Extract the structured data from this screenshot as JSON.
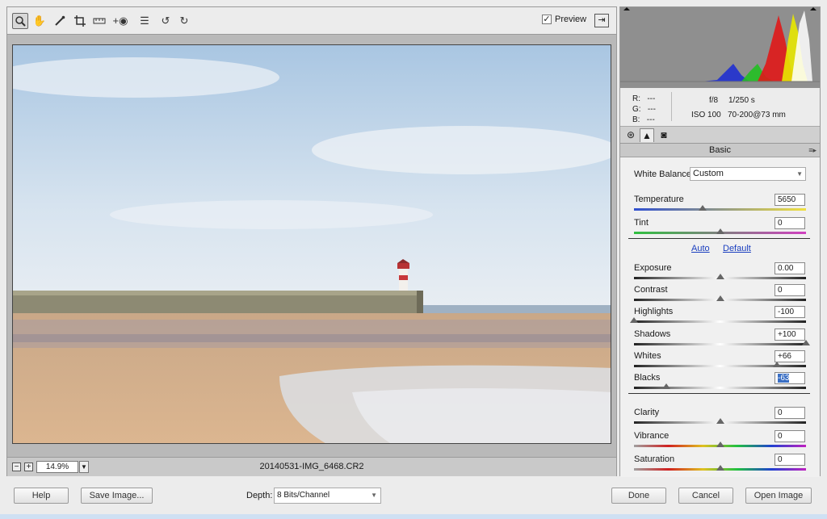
{
  "toolbar": {
    "tools": [
      "zoom-tool",
      "hand-tool",
      "white-balance-tool",
      "crop-tool",
      "straighten-tool",
      "red-eye-tool",
      "preferences-tool",
      "rotate-ccw-tool",
      "rotate-cw-tool"
    ],
    "preview_label": "Preview",
    "preview_checked": true
  },
  "bottom_bar": {
    "zoom_out": "−",
    "zoom_in": "+",
    "zoom_value": "14.9%",
    "filename": "20140531-IMG_6468.CR2"
  },
  "info": {
    "r_label": "R:",
    "r_value": "---",
    "g_label": "G:",
    "g_value": "---",
    "b_label": "B:",
    "b_value": "---",
    "aperture": "f/8",
    "shutter": "1/250 s",
    "iso": "ISO 100",
    "lens": "70-200@73 mm"
  },
  "panel": {
    "title": "Basic",
    "white_balance_label": "White Balance:",
    "white_balance_value": "Custom",
    "auto_link": "Auto",
    "default_link": "Default"
  },
  "sliders": [
    {
      "label": "Temperature",
      "value": "5650",
      "position": 0.4
    },
    {
      "label": "Tint",
      "value": "0",
      "position": 0.5
    },
    {
      "label": "Exposure",
      "value": "0.00",
      "position": 0.5
    },
    {
      "label": "Contrast",
      "value": "0",
      "position": 0.5
    },
    {
      "label": "Highlights",
      "value": "-100",
      "position": 0.0
    },
    {
      "label": "Shadows",
      "value": "+100",
      "position": 1.0
    },
    {
      "label": "Whites",
      "value": "+66",
      "position": 0.83
    },
    {
      "label": "Blacks",
      "value": "-63",
      "position": 0.19
    },
    {
      "label": "Clarity",
      "value": "0",
      "position": 0.5
    },
    {
      "label": "Vibrance",
      "value": "0",
      "position": 0.5
    },
    {
      "label": "Saturation",
      "value": "0",
      "position": 0.5
    }
  ],
  "footer": {
    "help": "Help",
    "save_image": "Save Image...",
    "depth_label": "Depth:",
    "depth_value": "8 Bits/Channel",
    "done": "Done",
    "cancel": "Cancel",
    "open_image": "Open Image"
  }
}
